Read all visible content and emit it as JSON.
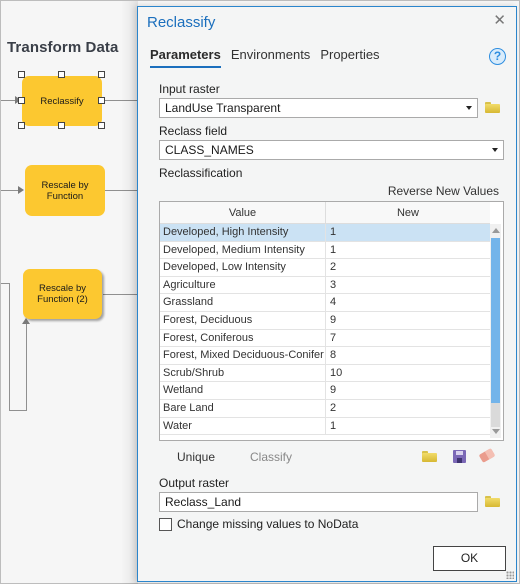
{
  "canvas": {
    "group_title": "Transform Data",
    "nodes": [
      {
        "label": "Reclassify",
        "selected": true
      },
      {
        "label": "Rescale by Function",
        "selected": false
      },
      {
        "label": "Rescale by Function (2)",
        "selected": false
      }
    ]
  },
  "dialog": {
    "title": "Reclassify",
    "close_icon": "close-icon",
    "tabs": [
      {
        "label": "Parameters",
        "active": true
      },
      {
        "label": "Environments",
        "active": false
      },
      {
        "label": "Properties",
        "active": false
      }
    ],
    "help_icon": "?",
    "input_raster": {
      "label": "Input raster",
      "value": "LandUse Transparent"
    },
    "reclass_field": {
      "label": "Reclass field",
      "value": "CLASS_NAMES"
    },
    "reclassification": {
      "label": "Reclassification",
      "reverse_label": "Reverse New Values",
      "columns": [
        "Value",
        "New"
      ],
      "rows": [
        {
          "value": "Developed, High Intensity",
          "new": "1",
          "selected": true
        },
        {
          "value": "Developed, Medium Intensity",
          "new": "1"
        },
        {
          "value": "Developed, Low Intensity",
          "new": "2"
        },
        {
          "value": "Agriculture",
          "new": "3"
        },
        {
          "value": "Grassland",
          "new": "4"
        },
        {
          "value": "Forest, Deciduous",
          "new": "9"
        },
        {
          "value": "Forest, Coniferous",
          "new": "7"
        },
        {
          "value": "Forest, Mixed Deciduous-Conifer",
          "new": "8"
        },
        {
          "value": "Scrub/Shrub",
          "new": "10"
        },
        {
          "value": "Wetland",
          "new": "9"
        },
        {
          "value": "Bare Land",
          "new": "2"
        },
        {
          "value": "Water",
          "new": "1"
        }
      ],
      "unique_label": "Unique",
      "classify_label": "Classify"
    },
    "output_raster": {
      "label": "Output raster",
      "value": "Reclass_Land"
    },
    "missing_nodata": {
      "label": "Change missing values to NoData",
      "checked": false
    },
    "ok_label": "OK",
    "colors": {
      "accent": "#1b6fbd",
      "node_fill": "#fcc830",
      "selected_row": "#cbe2f4",
      "scroll_thumb": "#73b4ea"
    }
  }
}
